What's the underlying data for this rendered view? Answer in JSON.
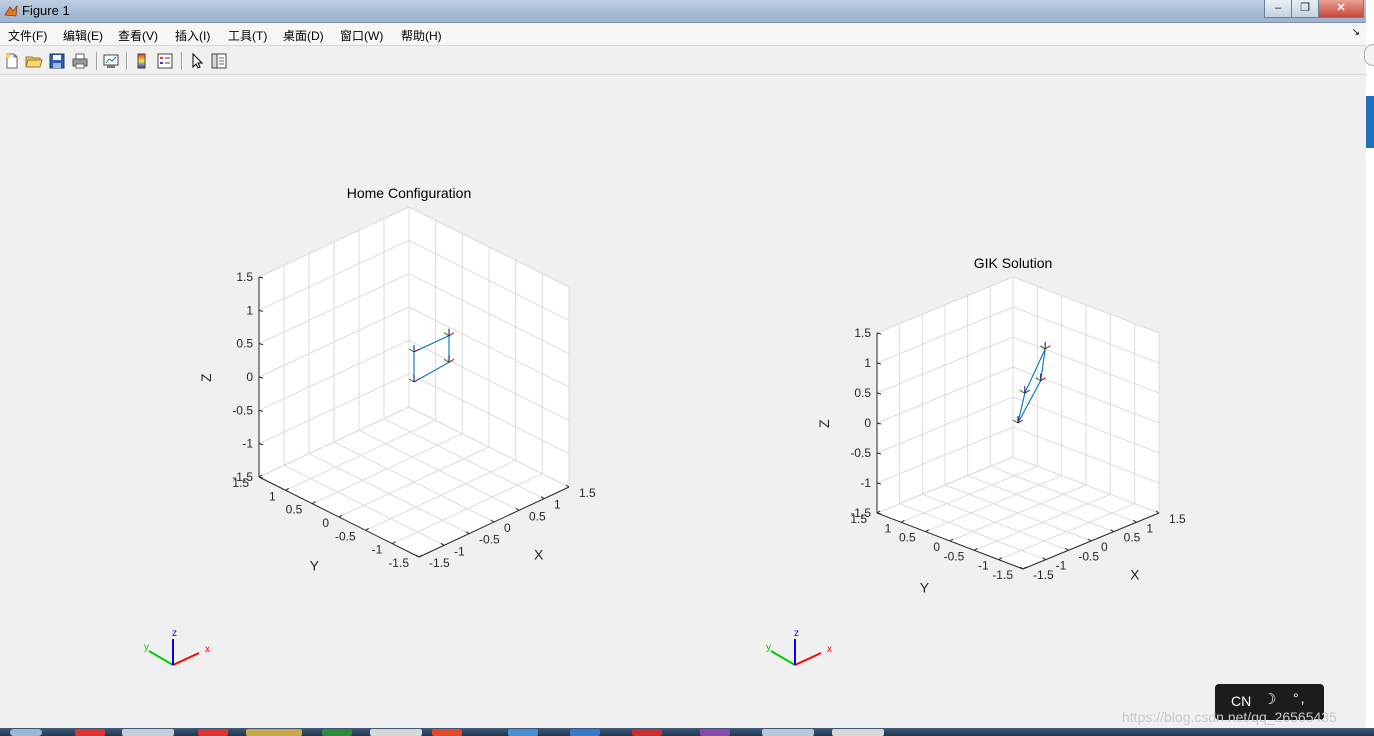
{
  "window": {
    "title": "Figure 1",
    "buttons": {
      "minimize": "‒",
      "maximize": "❐",
      "close": "✕"
    }
  },
  "menubar": {
    "items": [
      "文件(F)",
      "编辑(E)",
      "查看(V)",
      "插入(I)",
      "工具(T)",
      "桌面(D)",
      "窗口(W)",
      "帮助(H)"
    ],
    "overflow_arrow": "↘"
  },
  "toolbar": {
    "icons": [
      "new-figure-icon",
      "open-file-icon",
      "save-icon",
      "print-icon",
      "link-plot-icon",
      "colorbar-icon",
      "legend-icon",
      "edit-plot-pointer-icon",
      "plot-browser-icon"
    ]
  },
  "chart_data": [
    {
      "type": "line",
      "title": "Home Configuration",
      "xlabel": "X",
      "ylabel": "Y",
      "zlabel": "Z",
      "xlim": [
        -1.5,
        1.5
      ],
      "ylim": [
        -1.5,
        1.5
      ],
      "zlim": [
        -1.5,
        1.5
      ],
      "x_ticks": [
        "-1.5",
        "-1",
        "-0.5",
        "0",
        "0.5",
        "1",
        "1.5"
      ],
      "y_ticks": [
        "-1.5",
        "-1",
        "-0.5",
        "0",
        "0.5",
        "1",
        "1.5"
      ],
      "z_ticks": [
        "-1.5",
        "-1",
        "-0.5",
        "0",
        "0.5",
        "1",
        "1.5"
      ],
      "grid": true,
      "robot_links": [
        [
          0,
          0,
          0
        ],
        [
          0,
          0,
          0.45
        ],
        [
          0.7,
          0,
          0.45
        ],
        [
          0.7,
          0,
          0.05
        ],
        [
          0,
          0,
          0
        ]
      ],
      "frame_markers": [
        [
          0,
          0,
          0
        ],
        [
          0,
          0,
          0.45
        ],
        [
          0.7,
          0,
          0.45
        ],
        [
          0.7,
          0,
          0.05
        ]
      ],
      "colors": {
        "robot_line": "#0072bd",
        "grid": "#dcdcdc",
        "axis_triad_x": "#ff0000",
        "axis_triad_y": "#00cc00",
        "axis_triad_z": "#0000ff"
      },
      "triad_labels": [
        "x",
        "y",
        "z"
      ]
    },
    {
      "type": "line",
      "title": "GIK Solution",
      "xlabel": "X",
      "ylabel": "Y",
      "zlabel": "Z",
      "xlim": [
        -1.5,
        1.5
      ],
      "ylim": [
        -1.5,
        1.5
      ],
      "zlim": [
        -1.5,
        1.5
      ],
      "x_ticks": [
        "-1.5",
        "-1",
        "-0.5",
        "0",
        "0.5",
        "1",
        "1.5"
      ],
      "y_ticks": [
        "-1.5",
        "-1",
        "-0.5",
        "0",
        "0.5",
        "1",
        "1.5"
      ],
      "z_ticks": [
        "-1.5",
        "-1",
        "-0.5",
        "0",
        "0.5",
        "1",
        "1.5"
      ],
      "grid": true,
      "robot_links": [
        [
          0,
          0,
          0
        ],
        [
          0.15,
          0,
          0.45
        ],
        [
          0.6,
          0,
          1.05
        ],
        [
          0.5,
          0,
          0.55
        ],
        [
          0,
          0,
          0
        ]
      ],
      "frame_markers": [
        [
          0,
          0,
          0
        ],
        [
          0.15,
          0,
          0.45
        ],
        [
          0.6,
          0,
          1.05
        ],
        [
          0.5,
          0,
          0.55
        ]
      ],
      "colors": {
        "robot_line": "#0072bd",
        "grid": "#dcdcdc",
        "axis_triad_x": "#ff0000",
        "axis_triad_y": "#00cc00",
        "axis_triad_z": "#0000ff"
      },
      "triad_labels": [
        "x",
        "y",
        "z"
      ]
    }
  ],
  "ime": {
    "lang": "CN",
    "moon": "☽",
    "punct": "°,"
  },
  "watermark": "https://blog.csdn.net/qq_26565435"
}
